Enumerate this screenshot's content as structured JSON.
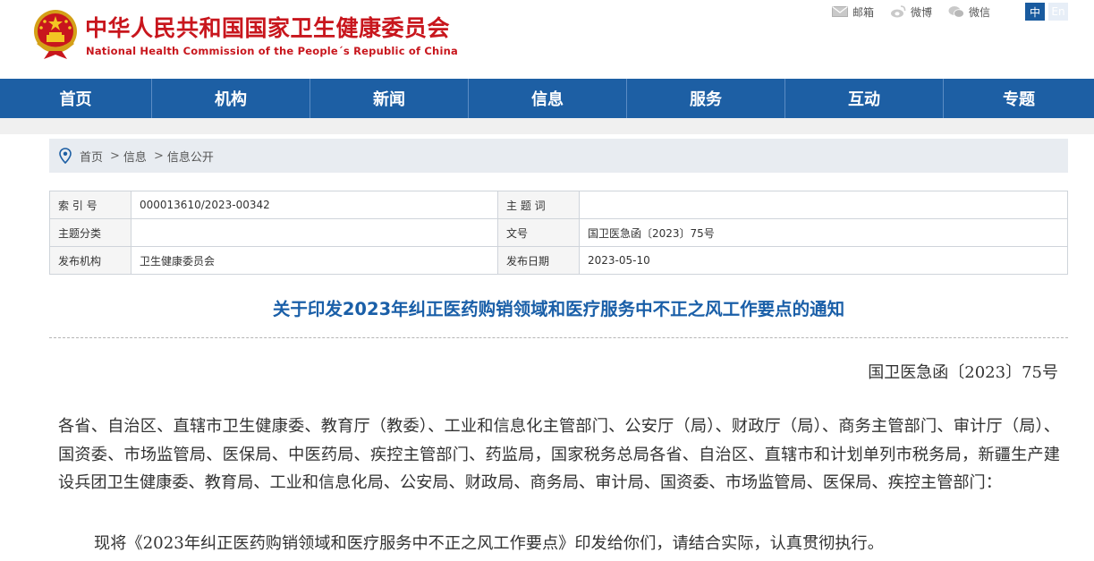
{
  "header": {
    "title": "中华人民共和国国家卫生健康委员会",
    "subtitle": "National Health Commission of the People´s Republic of China",
    "top_links": [
      {
        "label": "邮箱",
        "icon": "mail-icon"
      },
      {
        "label": "微博",
        "icon": "weibo-icon"
      },
      {
        "label": "微信",
        "icon": "wechat-icon"
      }
    ],
    "lang": {
      "zh": "中",
      "en": "En"
    }
  },
  "nav": {
    "items": [
      "首页",
      "机构",
      "新闻",
      "信息",
      "服务",
      "互动",
      "专题"
    ]
  },
  "breadcrumb": {
    "icon": "location-pin-icon",
    "items": [
      "首页",
      "信息",
      "信息公开"
    ],
    "separator": ">"
  },
  "meta": {
    "index_no_label": "索 引 号",
    "index_no_value": "000013610/2023-00342",
    "subject_word_label": "主 题 词",
    "subject_word_value": "",
    "subject_class_label": "主题分类",
    "subject_class_value": "",
    "doc_no_label": "文号",
    "doc_no_value": "国卫医急函〔2023〕75号",
    "issuer_label": "发布机构",
    "issuer_value": "卫生健康委员会",
    "date_label": "发布日期",
    "date_value": "2023-05-10"
  },
  "document": {
    "title": "关于印发2023年纠正医药购销领域和医疗服务中不正之风工作要点的通知",
    "number": "国卫医急函〔2023〕75号",
    "recipients": "各省、自治区、直辖市卫生健康委、教育厅（教委）、工业和信息化主管部门、公安厅（局）、财政厅（局）、商务主管部门、审计厅（局）、国资委、市场监管局、医保局、中医药局、疾控主管部门、药监局，国家税务总局各省、自治区、直辖市和计划单列市税务局，新疆生产建设兵团卫生健康委、教育局、工业和信息化局、公安局、财政局、商务局、审计局、国资委、市场监管局、医保局、疾控主管部门：",
    "body": "现将《2023年纠正医药购销领域和医疗服务中不正之风工作要点》印发给你们，请结合实际，认真贯彻执行。"
  },
  "colors": {
    "brand_red": "#c8161d",
    "nav_blue": "#1d5fa4",
    "title_blue": "#1a5fa8"
  }
}
